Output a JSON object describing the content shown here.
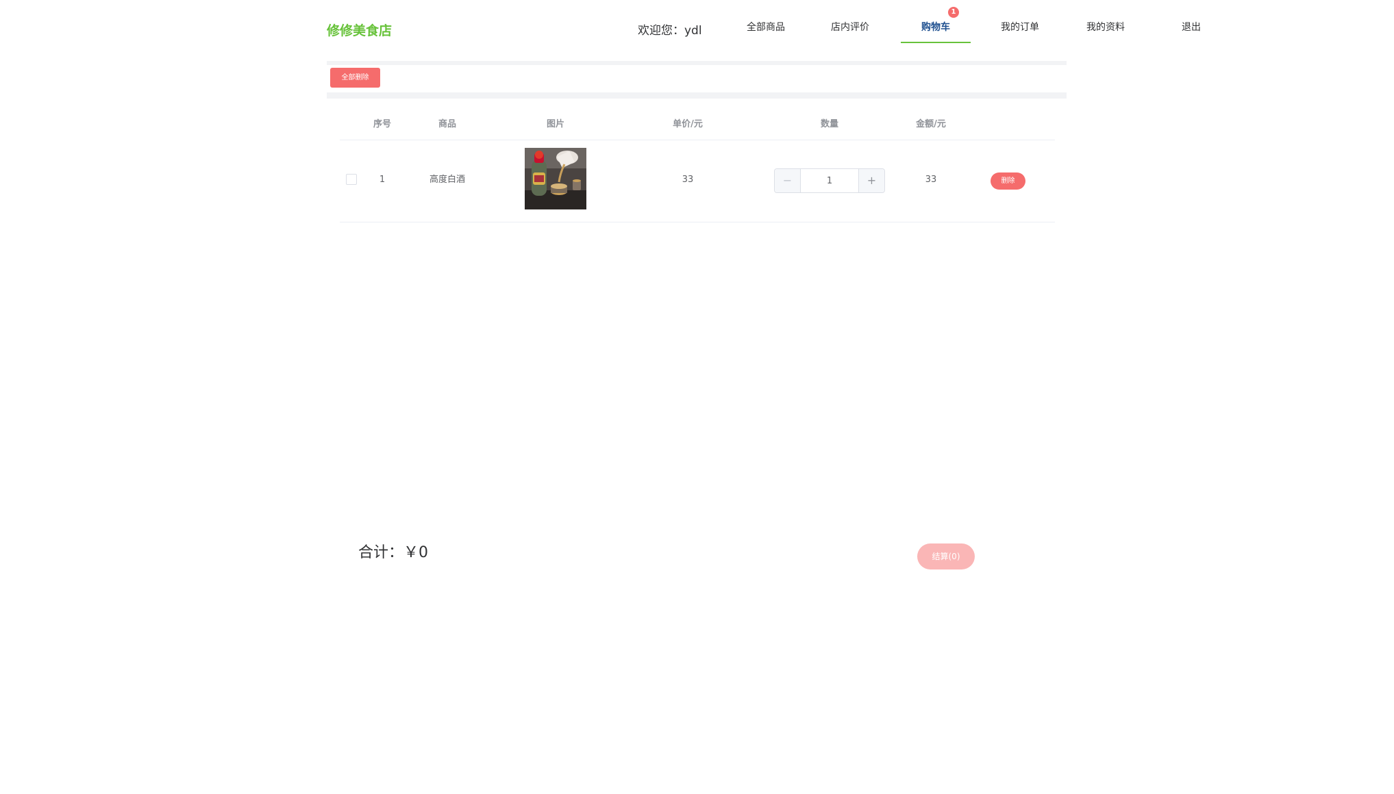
{
  "header": {
    "logo": "修修美食店",
    "welcome": "欢迎您：ydl",
    "nav": [
      {
        "label": "全部商品"
      },
      {
        "label": "店内评价"
      },
      {
        "label": "购物车",
        "badge": "1",
        "active": true
      },
      {
        "label": "我的订单"
      },
      {
        "label": "我的资料"
      },
      {
        "label": "退出"
      }
    ]
  },
  "toolbar": {
    "delete_all_label": "全部删除"
  },
  "table": {
    "columns": [
      "序号",
      "商品",
      "图片",
      "单价/元",
      "数量",
      "金额/元"
    ],
    "rows": [
      {
        "checked": false,
        "index": "1",
        "name": "高度白酒",
        "image_desc": "liquor-bottle-pouring-photo",
        "unit_price": "33",
        "quantity": "1",
        "amount": "33",
        "delete_label": "删除"
      }
    ]
  },
  "footer": {
    "total": "合计：￥0",
    "checkout_label": "结算(0)"
  },
  "colors": {
    "brand_green": "#67c23a",
    "danger": "#f56c6c",
    "danger_light": "#fab6b6",
    "active_nav": "#1e4f8f"
  }
}
